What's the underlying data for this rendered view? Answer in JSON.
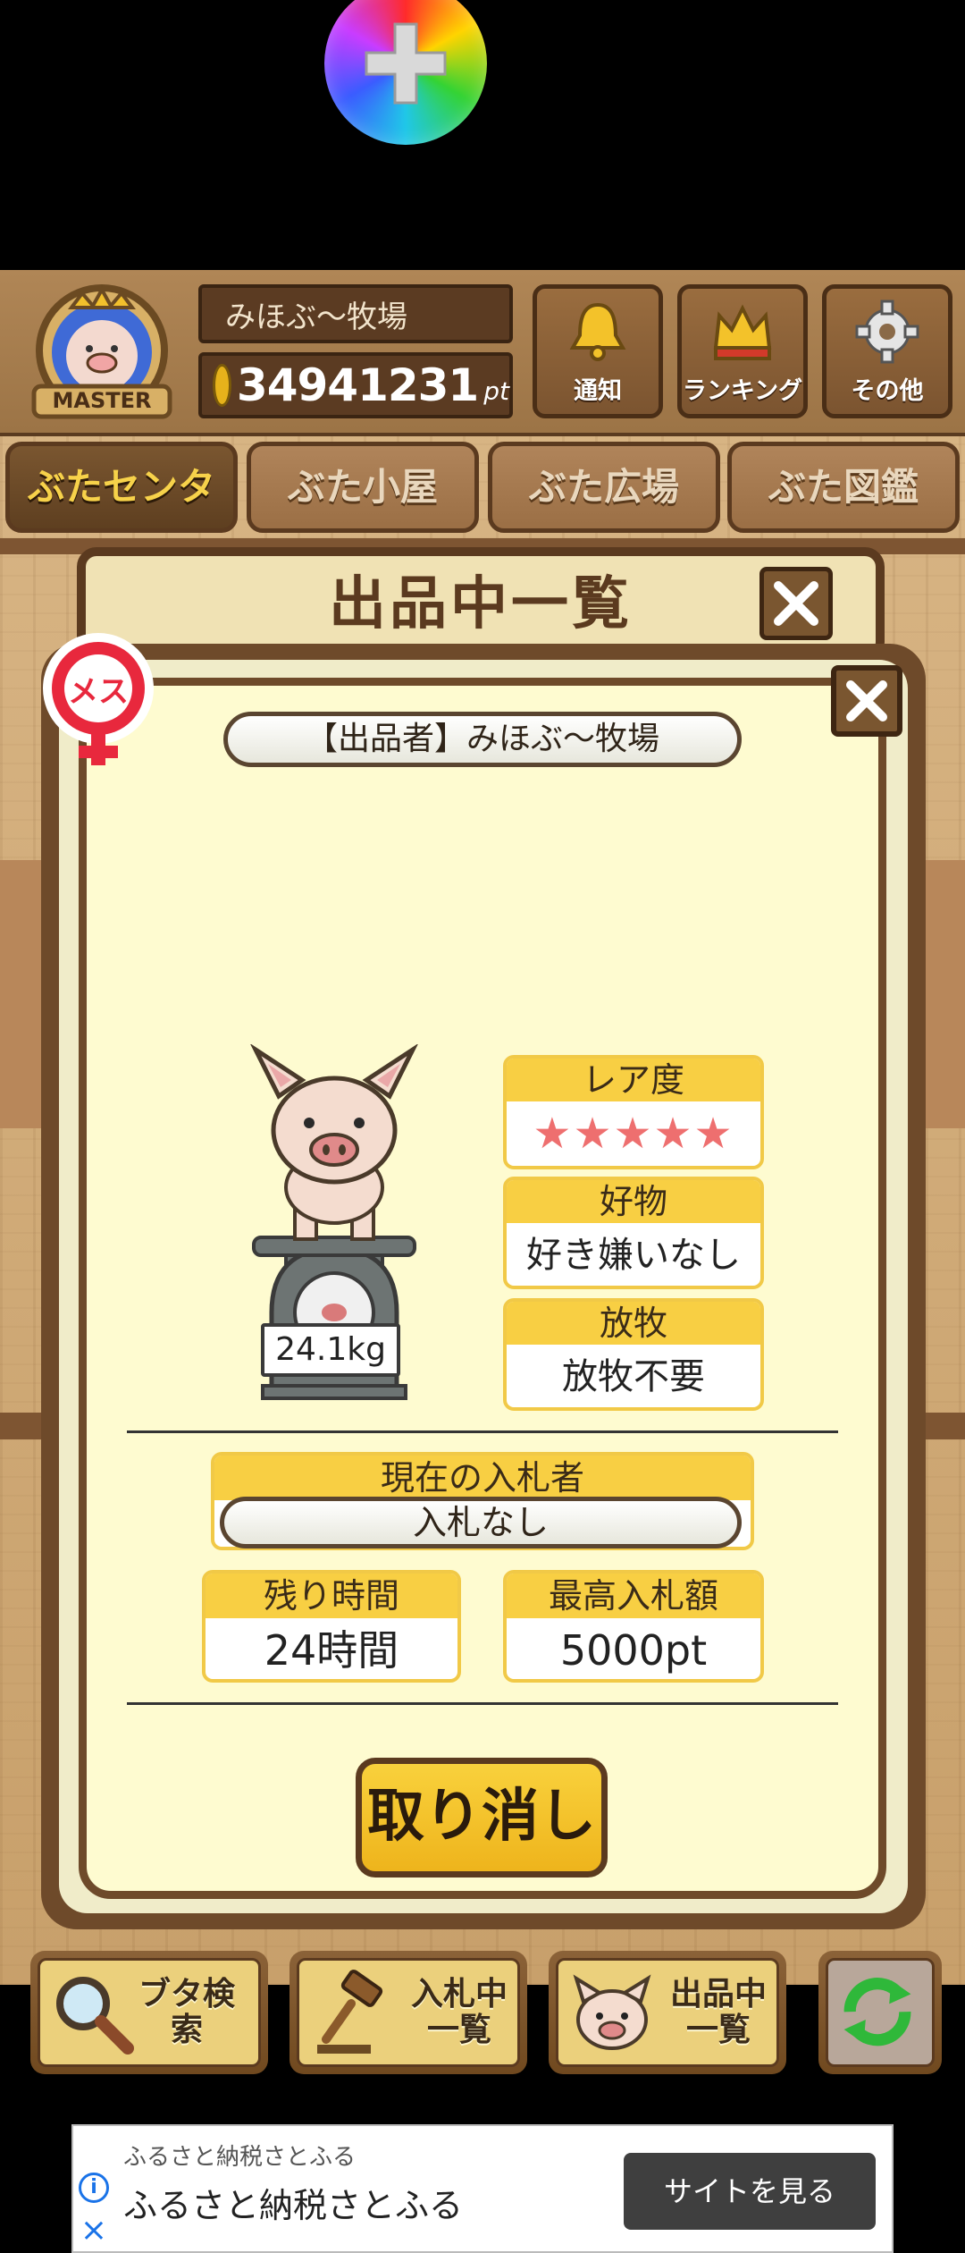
{
  "header": {
    "badge_text": "MASTER",
    "farm_name": "みほぶ〜牧場",
    "points_value": "34941231",
    "points_unit": "pt",
    "buttons": [
      {
        "label": "通知",
        "icon": "bell-icon"
      },
      {
        "label": "ランキング",
        "icon": "crown-icon"
      },
      {
        "label": "その他",
        "icon": "gear-icon"
      }
    ]
  },
  "nav_tabs": [
    {
      "label": "ぶたセンター",
      "active": true
    },
    {
      "label": "ぶた小屋",
      "active": false
    },
    {
      "label": "ぶた広場",
      "active": false
    },
    {
      "label": "ぶた図鑑",
      "active": false
    }
  ],
  "dialog": {
    "title": "出品中一覧",
    "gender_badge": "メス",
    "seller": "【出品者】みほぶ〜牧場",
    "weight": "24.1kg",
    "rarity_label": "レア度",
    "rarity_stars": "★★★★★",
    "rarity_value": 5,
    "likes_label": "好物",
    "likes_value": "好き嫌いなし",
    "graze_label": "放牧",
    "graze_value": "放牧不要",
    "bidder_label": "現在の入札者",
    "bidder_value": "入札なし",
    "time_label": "残り時間",
    "time_value": "24時間",
    "maxbid_label": "最高入札額",
    "maxbid_value": "5000pt",
    "cancel_label": "取り消し"
  },
  "actions": [
    {
      "label": "ブタ検索",
      "icon": "magnifier-icon"
    },
    {
      "label": "入札中\n一覧",
      "icon": "gavel-icon"
    },
    {
      "label": "出品中\n一覧",
      "icon": "pig-face-icon"
    },
    {
      "label": "",
      "icon": "refresh-icon"
    }
  ],
  "ad": {
    "advertiser": "ふるさと納税さとふる",
    "title": "ふるさと納税さとふる",
    "cta": "サイトを見る"
  },
  "colors": {
    "wood": "#c8a06b",
    "dark_wood": "#5b3a1f",
    "cream": "#fefbd0",
    "accent_yellow": "#f8cf43",
    "star_pink": "#ee6f6f",
    "female_red": "#e8283d"
  }
}
